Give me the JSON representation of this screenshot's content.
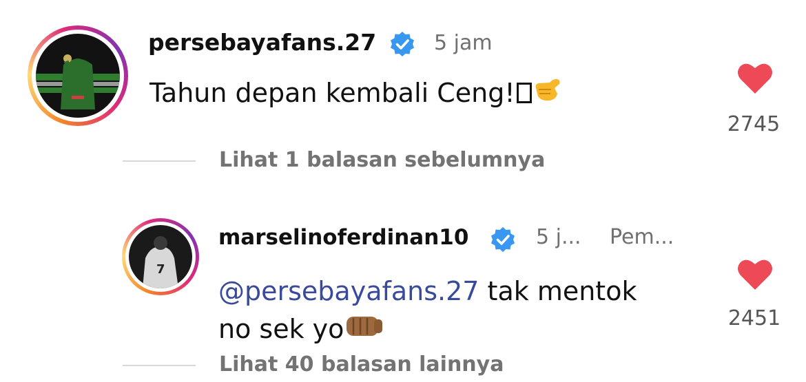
{
  "comments": [
    {
      "username": "persebayafans.27",
      "time": "5 jam",
      "text": "Tahun depan kembali Ceng!",
      "likes": "2745",
      "replies_link": "Lihat 1 balasan sebelumnya"
    },
    {
      "username": "marselinoferdinan10",
      "time": "5 j...",
      "extra": "Pem...",
      "mention": "@persebayafans.27",
      "text_line1": " tak mentok",
      "text_line2": "no sek yo",
      "likes": "2451",
      "replies_link": "Lihat 40 balasan lainnya"
    }
  ],
  "colors": {
    "heart": "#ed4956",
    "verified": "#3897f0",
    "mention": "#3a4a9a"
  },
  "icons": [
    "verified-badge-icon",
    "heart-icon",
    "call-me-hand-emoji",
    "fist-emoji"
  ]
}
